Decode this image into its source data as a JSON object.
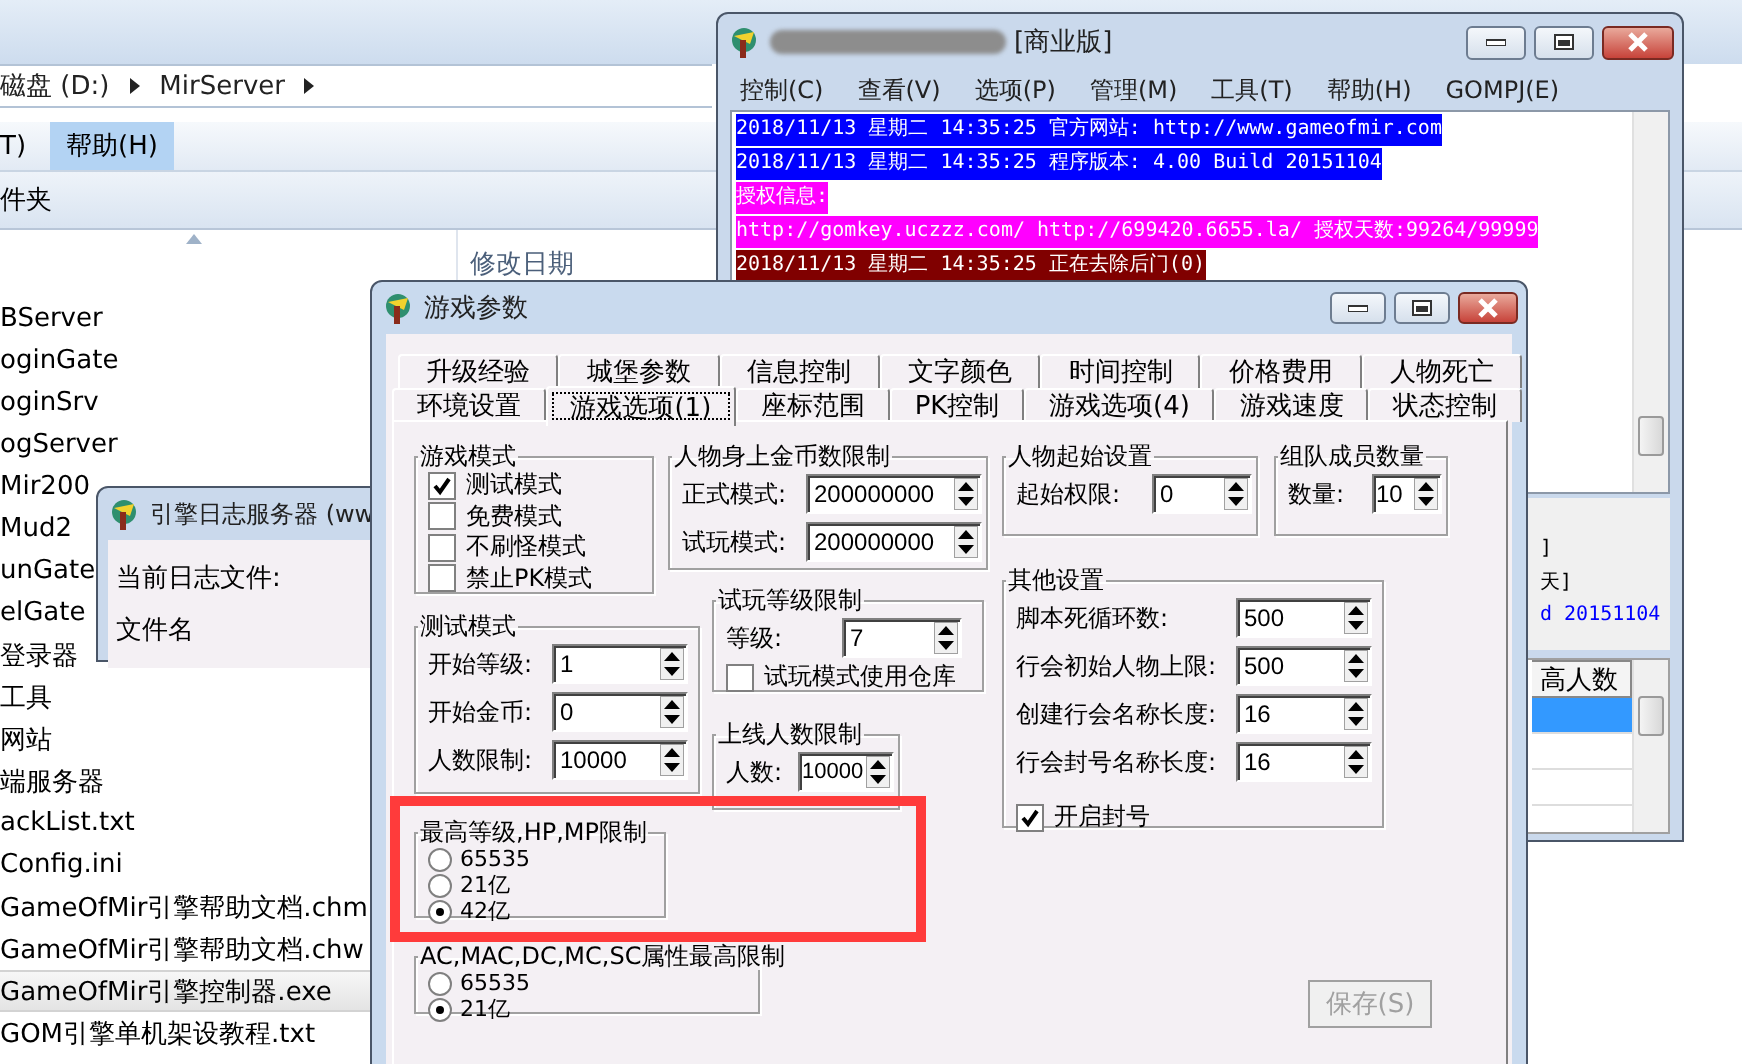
{
  "explorer": {
    "breadcrumb": [
      {
        "label": "磁盘 (D:)"
      },
      {
        "label": "MirServer"
      }
    ],
    "menu": [
      {
        "label": "T)",
        "selected": false
      },
      {
        "label": "帮助(H)",
        "selected": true
      }
    ],
    "toolbar_item": "件夹",
    "column_header": "修改日期",
    "files": [
      {
        "name": "BServer",
        "selected": false
      },
      {
        "name": "oginGate",
        "selected": false
      },
      {
        "name": "oginSrv",
        "selected": false
      },
      {
        "name": "ogServer",
        "selected": false
      },
      {
        "name": "Mir200",
        "selected": false
      },
      {
        "name": "Mud2",
        "selected": false
      },
      {
        "name": "unGate",
        "selected": false
      },
      {
        "name": "elGate",
        "selected": false
      },
      {
        "name": "登录器",
        "selected": false
      },
      {
        "name": "工具",
        "selected": false
      },
      {
        "name": "网站",
        "selected": false
      },
      {
        "name": "端服务器",
        "selected": false
      },
      {
        "name": "ackList.txt",
        "selected": false
      },
      {
        "name": "Config.ini",
        "selected": false
      },
      {
        "name": "GameOfMir引擎帮助文档.chm",
        "selected": false
      },
      {
        "name": "GameOfMir引擎帮助文档.chw",
        "selected": false
      },
      {
        "name": "GameOfMir引擎控制器.exe",
        "selected": true
      },
      {
        "name": "GOM引擎单机架设教程.txt",
        "selected": false
      }
    ]
  },
  "log_window": {
    "title": "引擎日志服务器 (ww",
    "current_file_label": "当前日志文件:",
    "file_name_label": "文件名"
  },
  "main_window": {
    "title": "[商业版]",
    "menu": [
      "控制(C)",
      "查看(V)",
      "选项(P)",
      "管理(M)",
      "工具(T)",
      "帮助(H)",
      "GOMPJ(E)"
    ],
    "log_lines": [
      {
        "text": "2018/11/13 星期二 14:35:25 官方网站: http://www.gameofmir.com",
        "color": "#0000ff"
      },
      {
        "text": "2018/11/13 星期二 14:35:25 程序版本: 4.00 Build 20151104",
        "color": "#0000ff"
      },
      {
        "text": "授权信息:",
        "color": "#ff00ff"
      },
      {
        "text": "http://gomkey.uczzz.com/ http://699420.6655.la/ 授权天数:99264/99999",
        "color": "#ff00ff"
      },
      {
        "text": "2018/11/13 星期二 14:35:25 正在去除后门(0)",
        "color": "#800000"
      }
    ],
    "status_lines": [
      {
        "text": "]",
        "color": "#000000"
      },
      {
        "text": "天]",
        "color": "#000000"
      },
      {
        "text": "d 20151104",
        "color": "#0000ff"
      }
    ],
    "table_header": "高人数"
  },
  "dialog": {
    "title": "游戏参数",
    "tab_rows": [
      [
        {
          "label": "升级经验",
          "selected": false
        },
        {
          "label": "城堡参数",
          "selected": false
        },
        {
          "label": "信息控制",
          "selected": false
        },
        {
          "label": "文字颜色",
          "selected": false
        },
        {
          "label": "时间控制",
          "selected": false
        },
        {
          "label": "价格费用",
          "selected": false
        },
        {
          "label": "人物死亡",
          "selected": false
        }
      ],
      [
        {
          "label": "环境设置",
          "selected": false
        },
        {
          "label": "游戏选项(1)",
          "selected": true
        },
        {
          "label": "座标范围",
          "selected": false
        },
        {
          "label": "PK控制",
          "selected": false
        },
        {
          "label": "游戏选项(4)",
          "selected": false
        },
        {
          "label": "游戏速度",
          "selected": false
        },
        {
          "label": "状态控制",
          "selected": false
        }
      ]
    ],
    "game_mode": {
      "title": "游戏模式",
      "options": [
        {
          "label": "测试模式",
          "checked": true
        },
        {
          "label": "免费模式",
          "checked": false
        },
        {
          "label": "不刷怪模式",
          "checked": false
        },
        {
          "label": "禁止PK模式",
          "checked": false
        }
      ]
    },
    "test_mode": {
      "title": "测试模式",
      "fields": [
        {
          "label": "开始等级:",
          "value": "1"
        },
        {
          "label": "开始金币:",
          "value": "0"
        },
        {
          "label": "人数限制:",
          "value": "10000"
        }
      ]
    },
    "max_level_limit": {
      "title": "最高等级,HP,MP限制",
      "choices": [
        {
          "label": "65535",
          "selected": false
        },
        {
          "label": "21亿",
          "selected": false
        },
        {
          "label": "42亿",
          "selected": true
        }
      ]
    },
    "attribute_limit": {
      "title": "AC,MAC,DC,MC,SC属性最高限制",
      "choices": [
        {
          "label": "65535",
          "selected": false
        },
        {
          "label": "21亿",
          "selected": true
        }
      ]
    },
    "gold_limit": {
      "title": "人物身上金币数限制",
      "fields": [
        {
          "label": "正式模式:",
          "value": "200000000"
        },
        {
          "label": "试玩模式:",
          "value": "200000000"
        }
      ]
    },
    "trial_level": {
      "title": "试玩等级限制",
      "fields": [
        {
          "label": "等级:",
          "value": "7"
        }
      ],
      "options": [
        {
          "label": "试玩模式使用仓库",
          "checked": false
        }
      ]
    },
    "online_limit": {
      "title": "上线人数限制",
      "fields": [
        {
          "label": "人数:",
          "value": "10000"
        }
      ]
    },
    "start_settings": {
      "title": "人物起始设置",
      "fields": [
        {
          "label": "起始权限:",
          "value": "0"
        }
      ]
    },
    "team_size": {
      "title": "组队成员数量",
      "fields": [
        {
          "label": "数量:",
          "value": "10"
        }
      ]
    },
    "other_settings": {
      "title": "其他设置",
      "fields": [
        {
          "label": "脚本死循环数:",
          "value": "500"
        },
        {
          "label": "行会初始人物上限:",
          "value": "500"
        },
        {
          "label": "创建行会名称长度:",
          "value": "16"
        },
        {
          "label": "行会封号名称长度:",
          "value": "16"
        }
      ],
      "options": [
        {
          "label": "开启封号",
          "checked": true
        }
      ]
    },
    "save_button": {
      "label": "保存(S)",
      "disabled": true
    }
  }
}
